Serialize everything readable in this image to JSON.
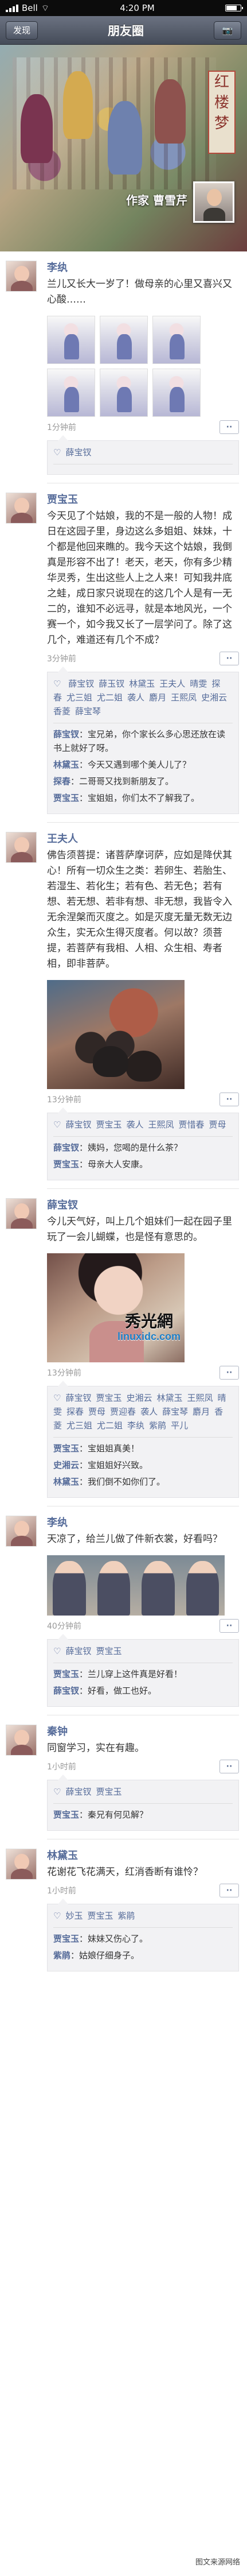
{
  "status": {
    "carrier": "Bell",
    "time": "4:20 PM"
  },
  "nav": {
    "back": "发现",
    "title": "朋友圈"
  },
  "cover": {
    "seal": "红楼梦",
    "author": "作家 曹雪芹"
  },
  "posts": [
    {
      "name": "李纨",
      "text": "兰儿又长大一岁了！做母亲的心里又喜兴又心酸……",
      "time": "1分钟前",
      "likes": [
        "薛宝钗"
      ],
      "comments": []
    },
    {
      "name": "贾宝玉",
      "text": "今天见了个姑娘，我的不是一般的人物！成日在这园子里，身边这么多姐姐、妹妹，十个都是他回来瞧的。我今天这个姑娘，我倒真是形容不出了！老天，老天，你有多少精华灵秀，生出这些人上之人来！可知我井底之蛙，成日家只说现在的这几个人是有一无二的，谁知不必远寻，就是本地风光，一个赛一个，如今我又长了一层学问了。除了这几个，难道还有几个不成？",
      "time": "3分钟前",
      "likes": [
        "薛宝钗",
        "薛玉钗",
        "林黛玉",
        "王夫人",
        "晴雯",
        "探春",
        "尤三姐",
        "尤二姐",
        "袭人",
        "麝月",
        "王熙凤",
        "史湘云",
        "香菱",
        "薛宝琴"
      ],
      "comments": [
        {
          "name": "薛宝钗",
          "text": "宝兄弟，你个家长么多心思还放在读书上就好了呀。"
        },
        {
          "name": "林黛玉",
          "text": "今天又遇到哪个美人儿了？"
        },
        {
          "name": "探春",
          "text": "二哥哥又找到新朋友了。"
        },
        {
          "name": "贾宝玉",
          "text": "宝姐姐，你们太不了解我了。"
        }
      ]
    },
    {
      "name": "王夫人",
      "text": "佛告须菩提：诸菩萨摩诃萨，应如是降伏其心！所有一切众生之类：若卵生、若胎生、若湿生、若化生；若有色、若无色；若有想、若无想、若非有想、非无想，我皆令入无余涅槃而灭度之。如是灭度无量无数无边众生，实无众生得灭度者。何以故？须菩提，若菩萨有我相、人相、众生相、寿者相，即非菩萨。",
      "time": "13分钟前",
      "likes": [
        "薛宝钗",
        "贾宝玉",
        "袭人",
        "王熙凤",
        "贾惜春",
        "贾母"
      ],
      "comments": [
        {
          "name": "薛宝钗",
          "text": "姨妈，您喝的是什么茶？"
        },
        {
          "name": "贾宝玉",
          "text": "母亲大人安康。"
        }
      ]
    },
    {
      "name": "薛宝钗",
      "text": "今儿天气好，叫上几个姐妹们一起在园子里玩了一会儿蝴蝶，也是怪有意思的。",
      "time": "13分钟前",
      "likes": [
        "薛宝钗",
        "贾宝玉",
        "史湘云",
        "林黛玉",
        "王熙凤",
        "晴雯",
        "探春",
        "贾母",
        "贾迎春",
        "袭人",
        "薛宝琴",
        "麝月",
        "香菱",
        "尤三姐",
        "尤二姐",
        "李纨",
        "紫鹃",
        "平儿"
      ],
      "comments": [
        {
          "name": "贾宝玉",
          "text": "宝姐姐真美！"
        },
        {
          "name": "史湘云",
          "text": "宝姐姐好兴致。"
        },
        {
          "name": "林黛玉",
          "text": "我们倒不如你们了。"
        }
      ]
    },
    {
      "name": "李纨",
      "text": "天凉了，给兰儿做了件新衣裳，好看吗？",
      "time": "40分钟前",
      "likes": [
        "薛宝钗",
        "贾宝玉"
      ],
      "comments": [
        {
          "name": "贾宝玉",
          "text": "兰儿穿上这件真是好看！"
        },
        {
          "name": "薛宝钗",
          "text": "好看，做工也好。"
        }
      ]
    },
    {
      "name": "秦钟",
      "text": "同窗学习，实在有趣。",
      "time": "1小时前",
      "likes": [
        "薛宝钗",
        "贾宝玉"
      ],
      "comments": [
        {
          "name": "贾宝玉",
          "text": "秦兄有何见解？"
        }
      ]
    },
    {
      "name": "林黛玉",
      "text": "花谢花飞花满天，红消香断有谁怜？",
      "time": "1小时前",
      "likes": [
        "妙玉",
        "贾宝玉",
        "紫鹃"
      ],
      "comments": [
        {
          "name": "贾宝玉",
          "text": "妹妹又伤心了。"
        },
        {
          "name": "紫鹃",
          "text": "姑娘仔细身子。"
        }
      ]
    }
  ],
  "watermark": {
    "title": "秀光網",
    "url": "linuxidc.com"
  },
  "footer": {
    "text": "图文来源网络"
  }
}
